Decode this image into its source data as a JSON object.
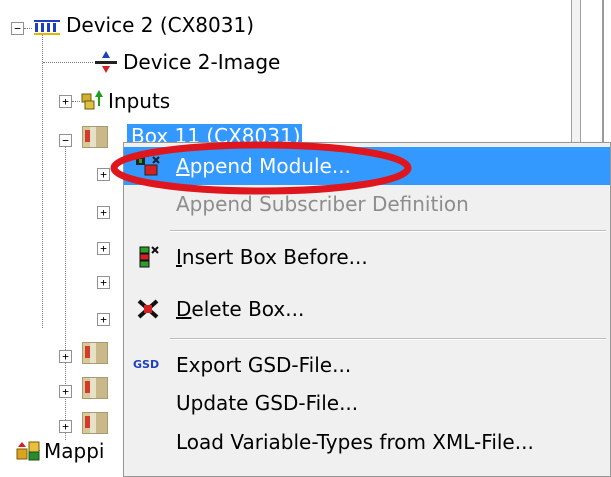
{
  "tree": {
    "device_label": "Device 2 (CX8031)",
    "image_label": "Device 2-Image",
    "inputs_label": "Inputs",
    "box_label": "Box 11 (CX8031)",
    "mapping_label": "Mappi"
  },
  "menu": {
    "items": [
      {
        "label": "Append Module...",
        "mnemonic": "A",
        "rest": "ppend Module..."
      },
      {
        "label": "Append Subscriber Definition"
      },
      {
        "label": "Insert Box Before...",
        "mnemonic": "I",
        "rest": "nsert Box Before..."
      },
      {
        "label": "Delete Box...",
        "mnemonic": "D",
        "rest": "elete Box..."
      },
      {
        "label": "Export GSD-File...",
        "icon_text": "GSD"
      },
      {
        "label": "Update GSD-File..."
      },
      {
        "label": "Load Variable-Types from XML-File..."
      }
    ]
  },
  "colors": {
    "selection": "#3399ff",
    "highlight_circle": "#e0161e",
    "menu_background": "#f0f0f0",
    "disabled_text": "#8d8d8d"
  }
}
